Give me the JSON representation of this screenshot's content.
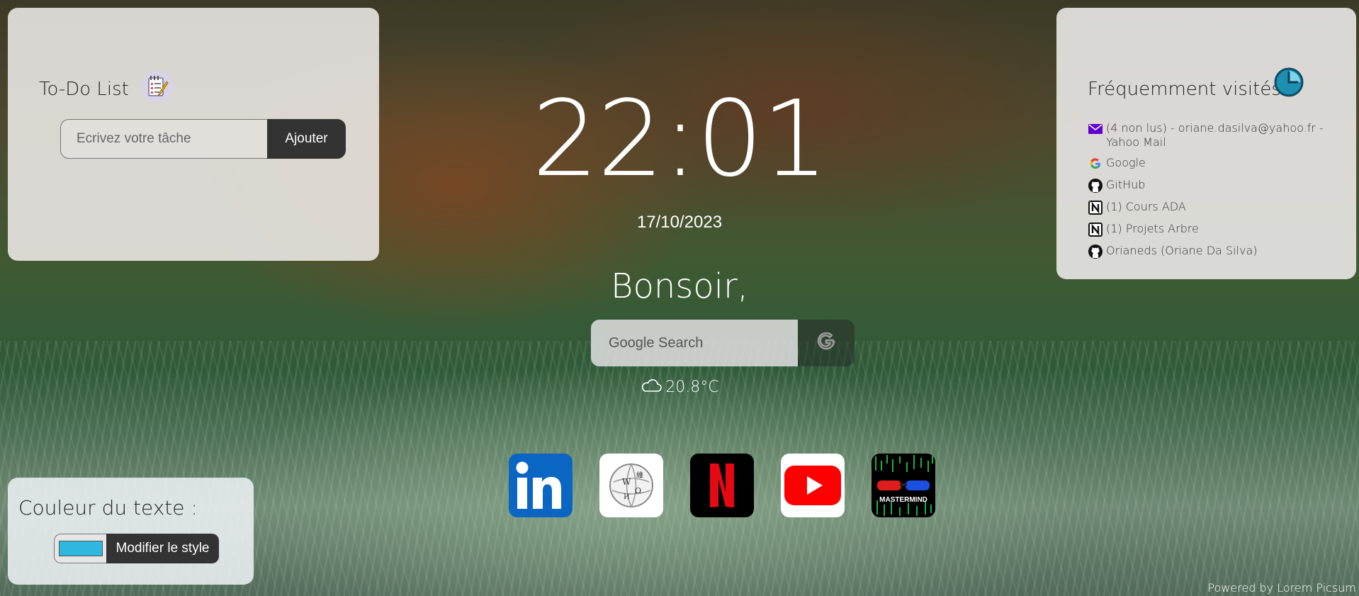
{
  "todo": {
    "title": "To-Do List",
    "input_placeholder": "Ecrivez votre tâche",
    "add_label": "Ajouter"
  },
  "frequent": {
    "title": "Fréquemment visités",
    "items": [
      {
        "icon": "mail-icon",
        "label": "(4 non lus) - oriane.dasilva@yahoo.fr - Yahoo Mail"
      },
      {
        "icon": "google-icon",
        "label": "Google"
      },
      {
        "icon": "github-icon",
        "label": "GitHub"
      },
      {
        "icon": "notion-icon",
        "label": "(1) Cours ADA"
      },
      {
        "icon": "notion-icon",
        "label": "(1) Projets Arbre"
      },
      {
        "icon": "github-icon",
        "label": "Orianeds (Oriane Da Silva)"
      }
    ]
  },
  "clock": {
    "time": "22:01",
    "date": "17/10/2023"
  },
  "greeting": "Bonsoir,",
  "search": {
    "placeholder": "Google Search"
  },
  "weather": {
    "temp": "20.8°C",
    "icon": "cloud-icon"
  },
  "apps": [
    {
      "name": "LinkedIn",
      "icon": "linkedin-icon",
      "color": "#0a66c2"
    },
    {
      "name": "Wikipedia",
      "icon": "wikipedia-icon",
      "color": "#ffffff"
    },
    {
      "name": "Netflix",
      "icon": "netflix-icon",
      "color": "#e50914"
    },
    {
      "name": "YouTube",
      "icon": "youtube-icon",
      "color": "#ff0000"
    },
    {
      "name": "Mastermind",
      "icon": "mastermind-icon",
      "label": "MASTERMIND"
    }
  ],
  "text_color": {
    "title": "Couleur du texte :",
    "value": "#2eb8e0",
    "button_label": "Modifier le style"
  },
  "footer": "Powered by Lorem Picsum"
}
